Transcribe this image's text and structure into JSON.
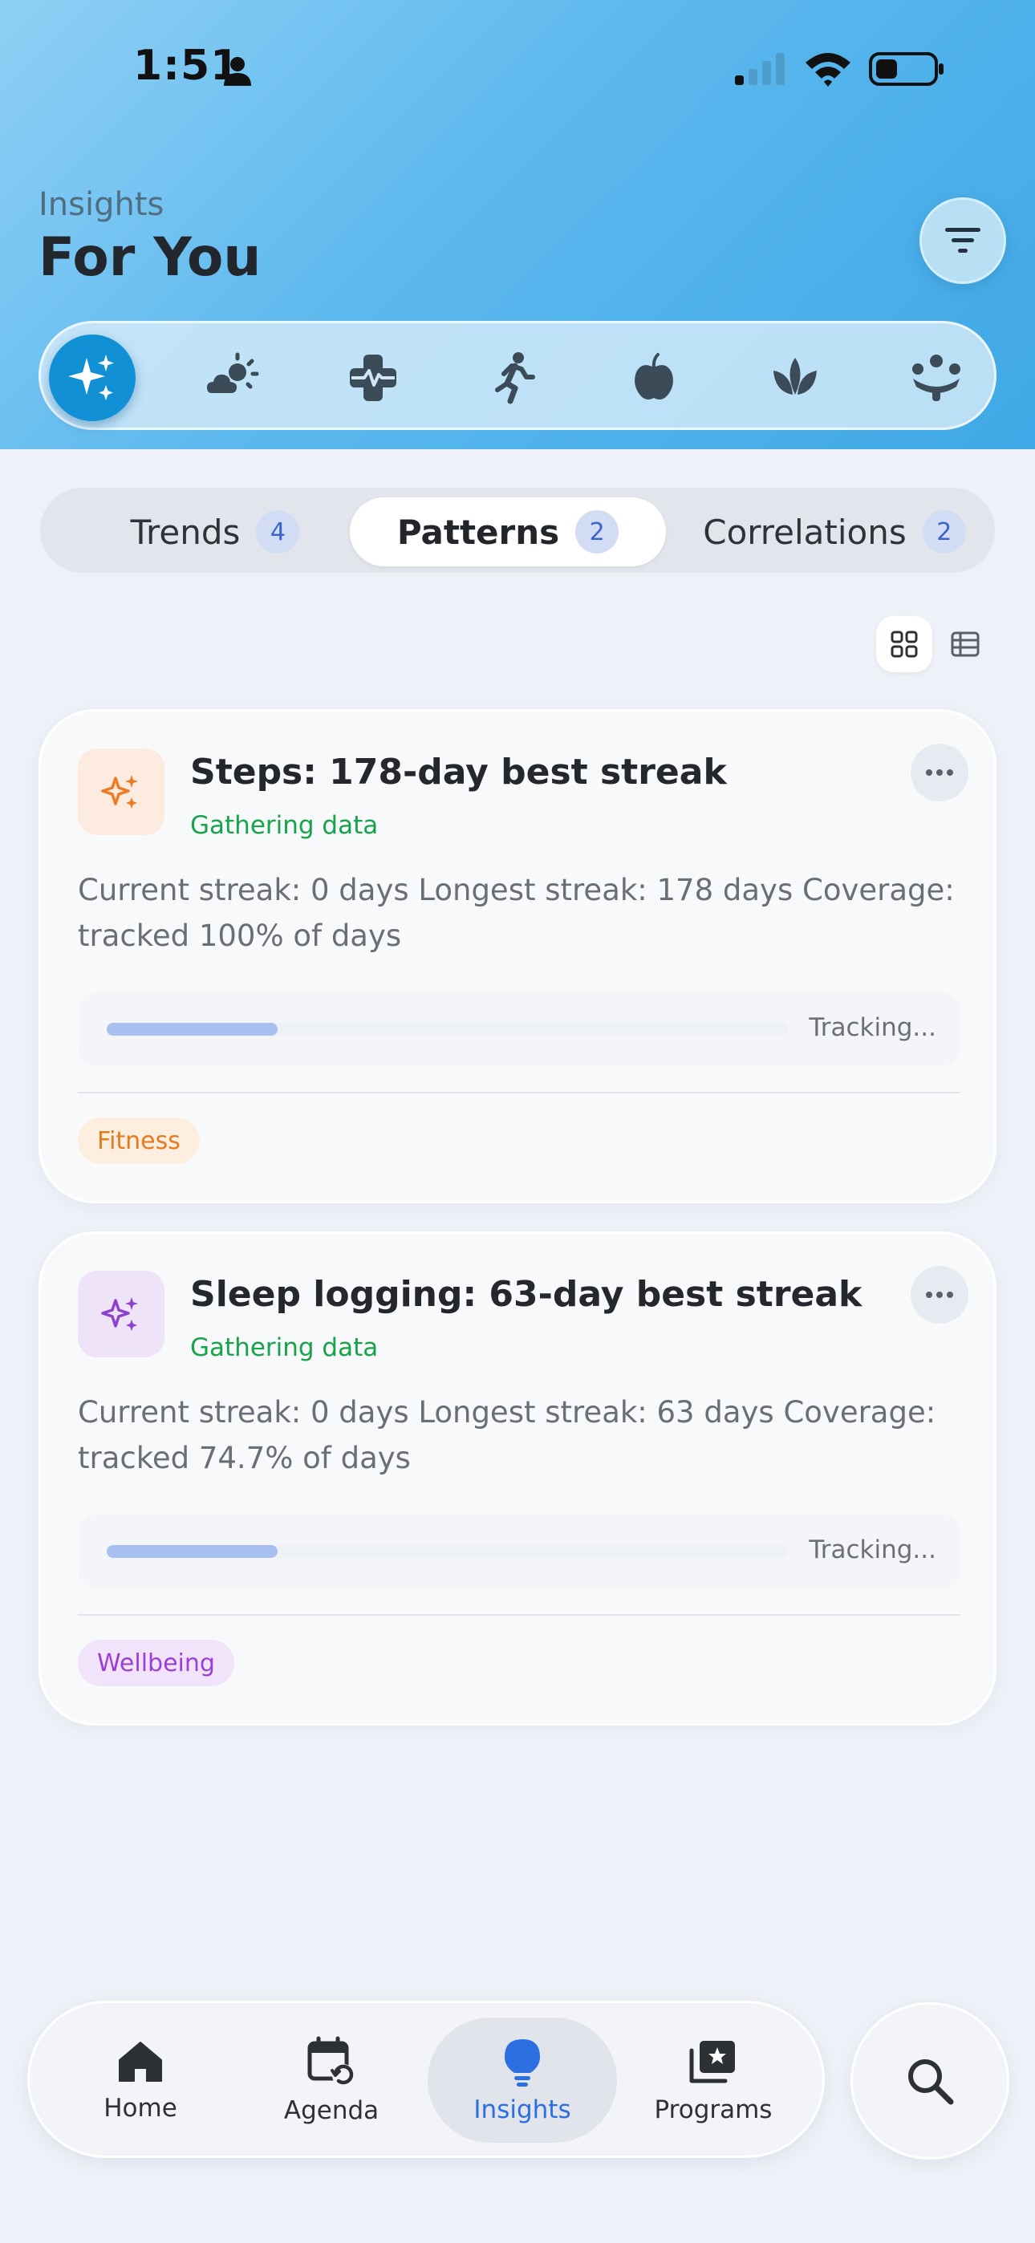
{
  "status_bar": {
    "time": "1:51"
  },
  "header": {
    "eyebrow": "Insights",
    "title": "For You",
    "categories": [
      {
        "icon": "sparkles-icon",
        "active": true
      },
      {
        "icon": "weather-icon",
        "active": false
      },
      {
        "icon": "medical-icon",
        "active": false
      },
      {
        "icon": "running-icon",
        "active": false
      },
      {
        "icon": "apple-icon",
        "active": false
      },
      {
        "icon": "lotus-icon",
        "active": false
      },
      {
        "icon": "community-icon",
        "active": false
      }
    ]
  },
  "segments": [
    {
      "label": "Trends",
      "count": "4",
      "active": false
    },
    {
      "label": "Patterns",
      "count": "2",
      "active": true
    },
    {
      "label": "Correlations",
      "count": "2",
      "active": false
    }
  ],
  "cards": [
    {
      "title": "Steps: 178-day best streak",
      "status": "Gathering data",
      "description": "Current streak: 0 days Longest streak: 178 days Coverage: tracked 100% of days",
      "progress_label": "Tracking...",
      "progress": 0.25,
      "tag": "Fitness",
      "tag_color": "#e67a1e",
      "tag_bg": "#fdeee0",
      "icon_color": "#ee7a24",
      "icon_bg": "#fdebe0"
    },
    {
      "title": "Sleep logging: 63-day best streak",
      "status": "Gathering data",
      "description": "Current streak: 0 days Longest streak: 63 days Coverage: tracked 74.7% of days",
      "progress_label": "Tracking...",
      "progress": 0.25,
      "tag": "Wellbeing",
      "tag_color": "#9b3fd6",
      "tag_bg": "#f1e4fa",
      "icon_color": "#8e3fd0",
      "icon_bg": "#efe3f8"
    }
  ],
  "tabbar": {
    "tabs": [
      {
        "label": "Home",
        "icon": "home-icon",
        "active": false
      },
      {
        "label": "Agenda",
        "icon": "calendar-icon",
        "active": false
      },
      {
        "label": "Insights",
        "icon": "lightbulb-icon",
        "active": true
      },
      {
        "label": "Programs",
        "icon": "programs-icon",
        "active": false
      }
    ]
  },
  "colors": {
    "accent": "#2b6fe0",
    "header_active": "#1290d6",
    "status_green": "#17a34a"
  }
}
